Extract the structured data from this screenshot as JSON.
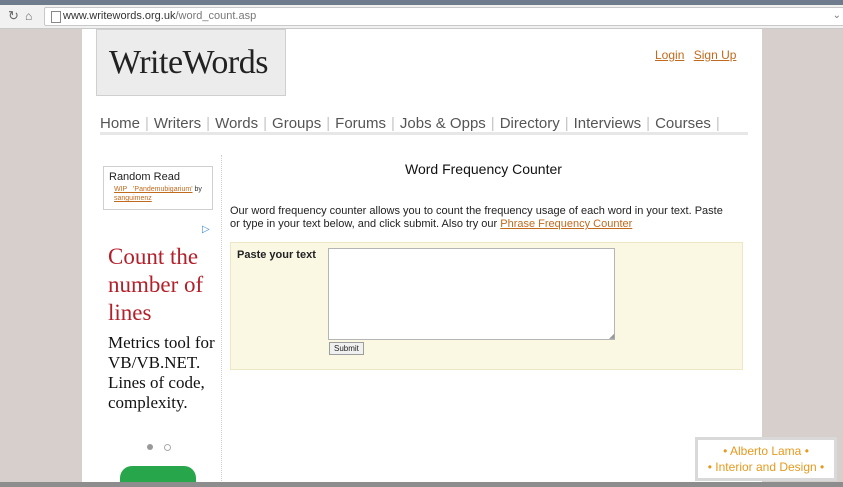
{
  "browser": {
    "url_domain": "www.writewords.org.uk",
    "url_path": "/word_count.asp"
  },
  "site": {
    "logo": "WriteWords",
    "auth_links": [
      "Login",
      "Sign Up"
    ]
  },
  "nav": {
    "items": [
      "Home",
      "Writers",
      "Words",
      "Groups",
      "Forums",
      "Jobs & Opps",
      "Directory",
      "Interviews",
      "Courses"
    ]
  },
  "sidebar": {
    "random_title": "Random Read",
    "random_link": "WIP_ 'Pandemubigarium'",
    "random_by": "by",
    "random_author": "sanguimenz",
    "ad_heading": "Count the number of lines",
    "ad_body": "Metrics tool for VB/VB.NET. Lines of code, complexity."
  },
  "content": {
    "title": "Word Frequency Counter",
    "description": "Our word frequency counter allows you to count the frequency usage of each word in your text. Paste or type in your text below, and click submit. Also try our",
    "phrase_link": "Phrase Frequency Counter",
    "paste_label": "Paste your text",
    "textarea_value": "",
    "submit_label": "Submit"
  },
  "watermark": {
    "line1": "• Alberto Lama •",
    "line2": "• Interior and Design •"
  },
  "colors": {
    "link": "#c06a1e",
    "ad_heading": "#b3202a",
    "form_bg": "#faf7e3",
    "watermark": "#e59a1f"
  }
}
